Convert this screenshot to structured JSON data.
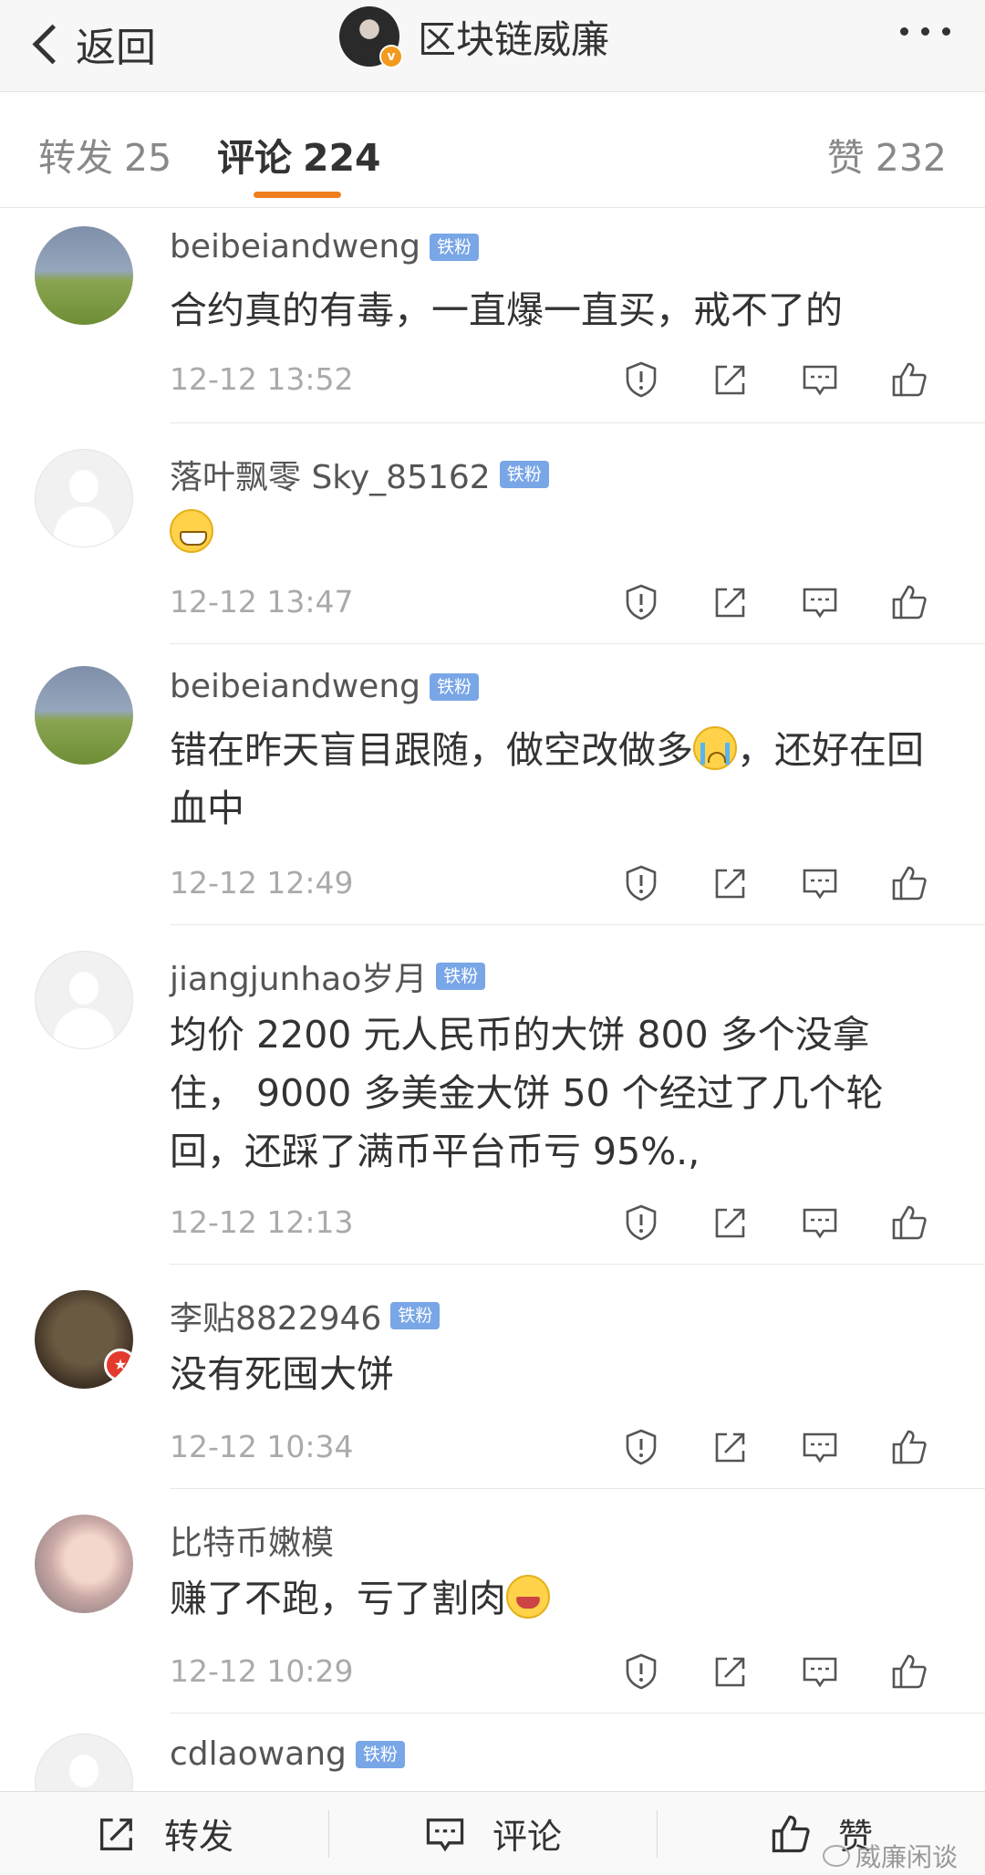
{
  "header": {
    "back_label": "返回",
    "title": "区块链威廉",
    "verified_badge": "v"
  },
  "tabs": {
    "forward_label": "转发",
    "forward_count": "25",
    "comment_label": "评论",
    "comment_count": "224",
    "like_label": "赞",
    "like_count": "232"
  },
  "fan_badge": "铁粉",
  "comments": [
    {
      "user": "beibeiandweng",
      "text": "合约真的有毒，一直爆一直买，戒不了的",
      "time": "12-12 13:52"
    },
    {
      "user": "落叶飘零 Sky_85162",
      "text": "",
      "time": "12-12 13:47"
    },
    {
      "user": "beibeiandweng",
      "text_a": "错在昨天盲目跟随，做空改做多",
      "text_b": "，还好在回血中",
      "time": "12-12 12:49"
    },
    {
      "user": "jiangjunhao岁月",
      "text": "均价 2200 元人民币的大饼 800 多个没拿住， 9000 多美金大饼 50 个经过了几个轮回，还踩了满币平台币亏 95%.,",
      "time": "12-12 12:13"
    },
    {
      "user": "李贴8822946",
      "text": "没有死囤大饼",
      "time": "12-12 10:34"
    },
    {
      "user": "比特币嫩模",
      "text": "赚了不跑，亏了割肉",
      "time": "12-12 10:29"
    },
    {
      "user": "cdlaowang"
    }
  ],
  "bottom_bar": {
    "forward_label": "转发",
    "comment_label": "评论",
    "like_label": "赞"
  },
  "watermark": "威廉闲谈",
  "colors": {
    "accent": "#f07f1e",
    "fan_badge": "#79a6e6",
    "verified": "#f29a1f"
  }
}
